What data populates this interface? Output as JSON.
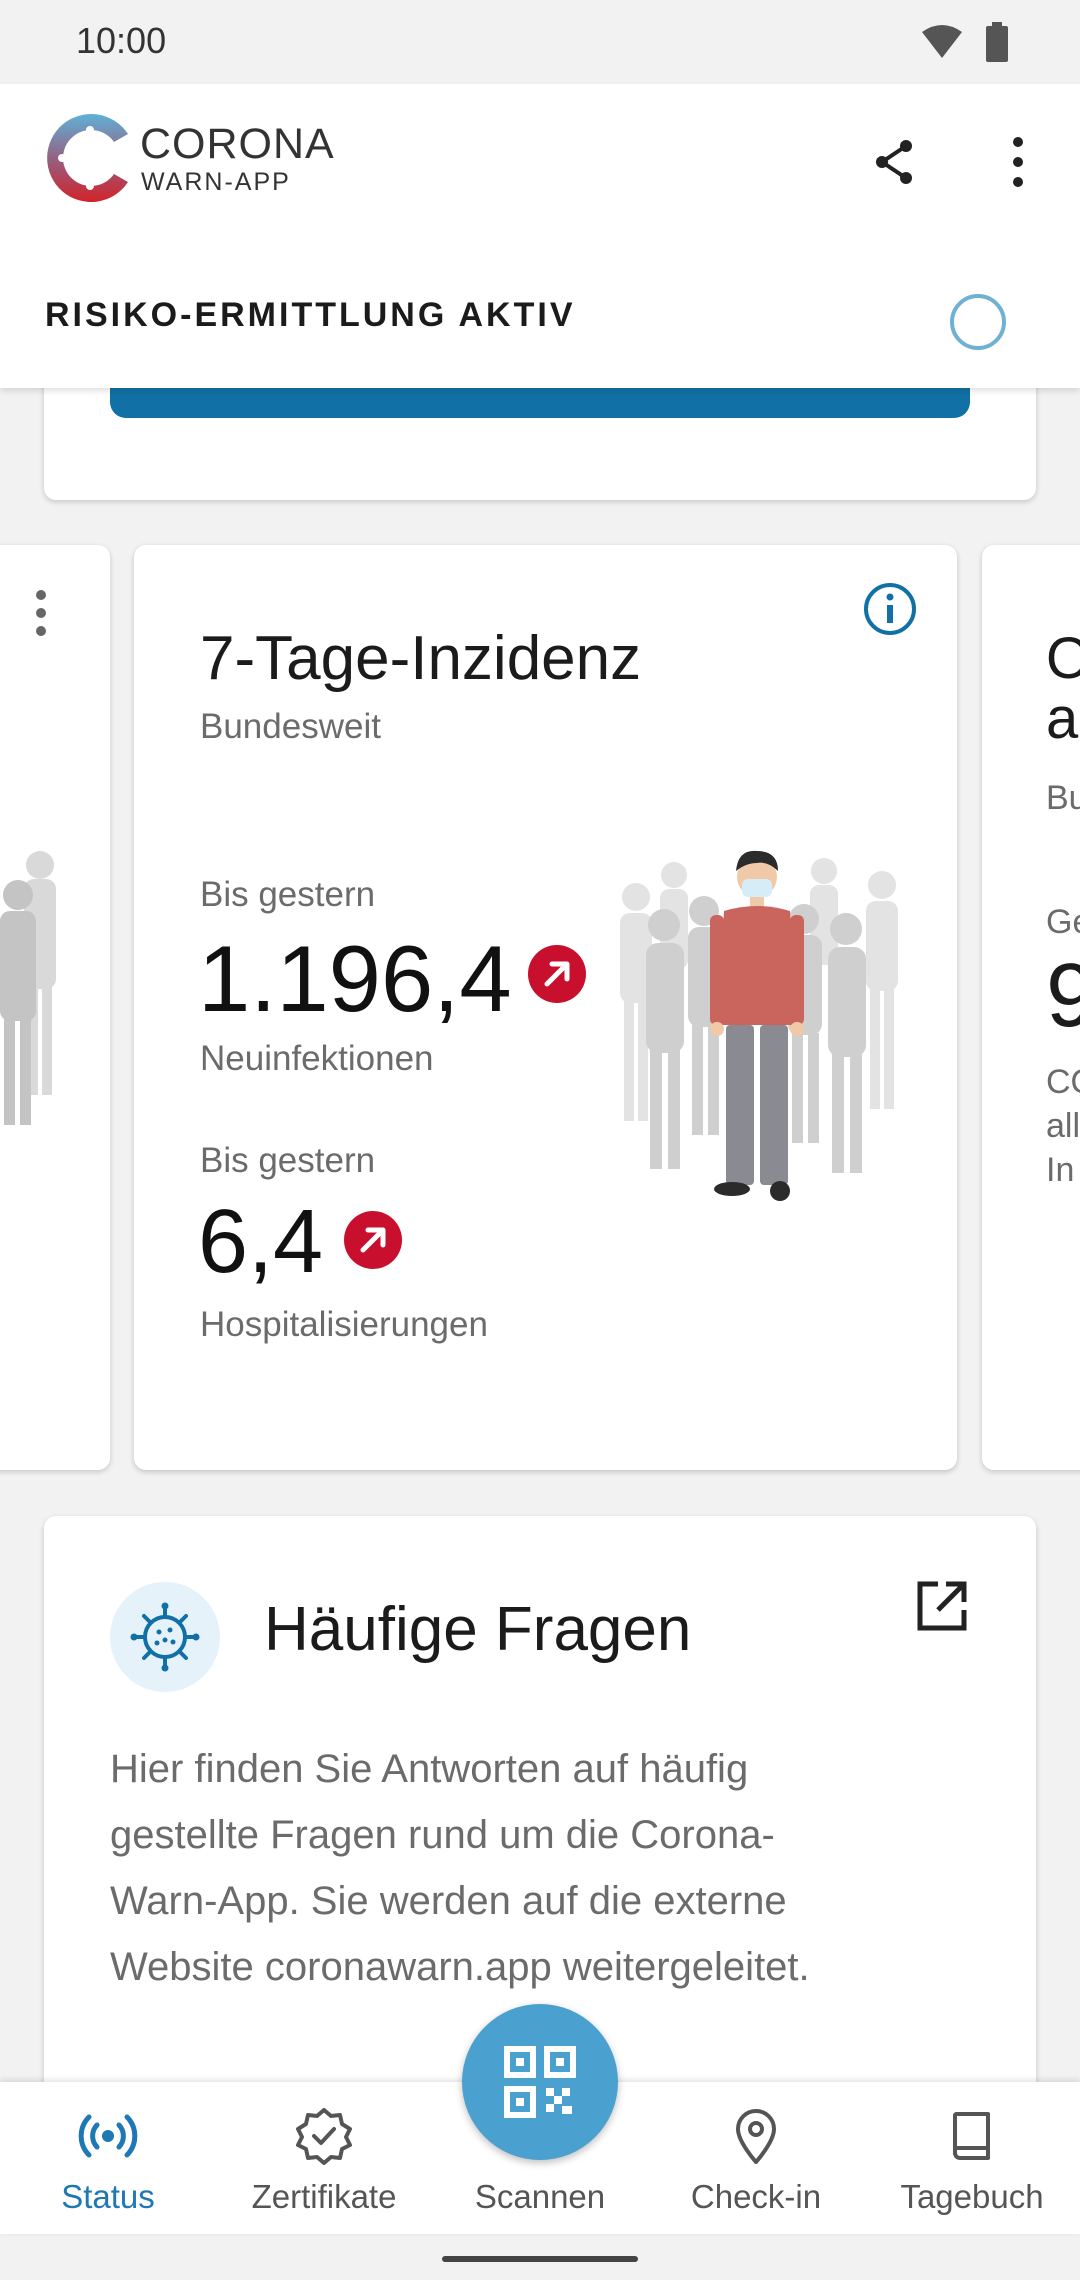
{
  "status_bar": {
    "time": "10:00"
  },
  "app_bar": {
    "logo_title": "CORONA",
    "logo_subtitle": "WARN-APP",
    "risk_status": "RISIKO-ERMITTLUNG AKTIV"
  },
  "right_card": {
    "title_lines": [
      "O",
      "a"
    ],
    "sub": "Bu",
    "label": "Ge",
    "value": "9",
    "desc_lines": [
      "CO",
      "all",
      "In"
    ]
  },
  "incidence_card": {
    "title": "7-Tage-Inzidenz",
    "subtitle": "Bundesweit",
    "block1": {
      "label": "Bis gestern",
      "value": "1.196,4",
      "caption": "Neuinfektionen",
      "trend": "up"
    },
    "block2": {
      "label": "Bis gestern",
      "value": "6,4",
      "caption": "Hospitalisierungen",
      "trend": "up"
    }
  },
  "faq_card": {
    "title": "Häufige Fragen",
    "text": "Hier finden Sie Antworten auf häufig gestellte Fragen rund um die Corona-Warn-App. Sie werden auf die externe Website coronawarn.app weitergeleitet."
  },
  "bottom_nav": {
    "items": [
      {
        "label": "Status",
        "active": true
      },
      {
        "label": "Zertifikate",
        "active": false
      },
      {
        "label": "Scannen",
        "active": false
      },
      {
        "label": "Check-in",
        "active": false
      },
      {
        "label": "Tagebuch",
        "active": false
      }
    ]
  },
  "colors": {
    "accent": "#1e78b4",
    "trend_red": "#c8102e",
    "primary_blue": "#1170a5",
    "fab": "#4aa0cf"
  }
}
